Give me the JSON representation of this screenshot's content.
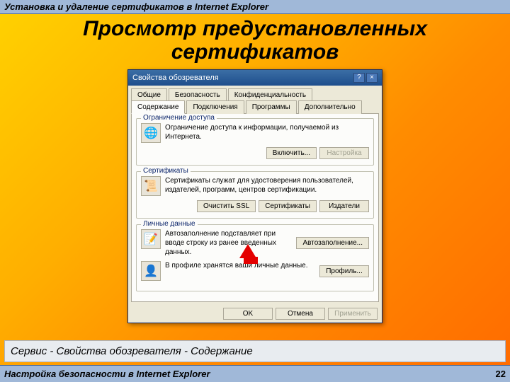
{
  "header": {
    "breadcrumb": "Установка и удаление сертификатов в Internet Explorer"
  },
  "title": "Просмотр предустановленных сертификатов",
  "dialog": {
    "title": "Свойства обозревателя",
    "help_btn": "?",
    "close_btn": "×",
    "tabs_row1": [
      "Общие",
      "Безопасность",
      "Конфиденциальность"
    ],
    "tabs_row2": [
      "Содержание",
      "Подключения",
      "Программы",
      "Дополнительно"
    ],
    "active_tab": "Содержание",
    "groups": {
      "access": {
        "title": "Ограничение доступа",
        "desc": "Ограничение доступа к информации, получаемой из Интернета.",
        "btn_enable": "Включить...",
        "btn_settings": "Настройка"
      },
      "certs": {
        "title": "Сертификаты",
        "desc": "Сертификаты служат для удостоверения пользователей, издателей, программ, центров сертификации.",
        "btn_ssl": "Очистить SSL",
        "btn_certs": "Сертификаты",
        "btn_pub": "Издатели"
      },
      "personal": {
        "title": "Личные данные",
        "auto_desc": "Автозаполнение подставляет при вводе строку из ранее введенных данных.",
        "btn_auto": "Автозаполнение...",
        "profile_desc": "В профиле хранятся ваши личные данные.",
        "btn_profile": "Профиль..."
      }
    },
    "buttons": {
      "ok": "OK",
      "cancel": "Отмена",
      "apply": "Применить"
    }
  },
  "path": "Сервис - Свойства обозревателя - Содержание",
  "footer": {
    "label": "Настройка безопасности в Internet Explorer",
    "page": "22"
  }
}
